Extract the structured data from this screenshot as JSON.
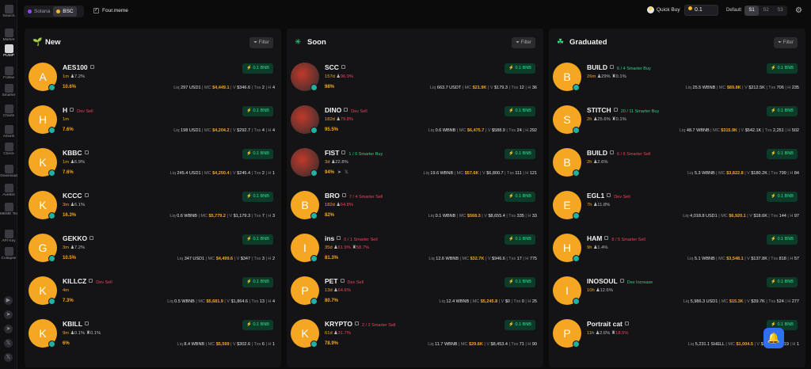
{
  "sidebar": {
    "items": [
      {
        "label": "Search",
        "icon": "search-icon"
      },
      {
        "label": "Market",
        "icon": "market-icon"
      },
      {
        "label": "PUMP",
        "icon": "pump-icon"
      },
      {
        "label": "Follow",
        "icon": "follow-icon"
      },
      {
        "label": "Smarter",
        "icon": "smarter-icon"
      },
      {
        "label": "Charts",
        "icon": "charts-icon"
      },
      {
        "label": "Assets",
        "icon": "assets-icon"
      },
      {
        "label": "Check",
        "icon": "check-icon"
      },
      {
        "label": "Download",
        "icon": "download-icon"
      },
      {
        "label": "AveBot",
        "icon": "avebot-icon"
      },
      {
        "label": "MEME Team",
        "icon": "meme-team-icon"
      },
      {
        "label": "API Key",
        "icon": "api-key-icon"
      },
      {
        "label": "Collapse",
        "icon": "collapse-icon"
      }
    ],
    "social": [
      "youtube-icon",
      "telegram-icon",
      "telegram-icon",
      "x-icon",
      "x-icon"
    ]
  },
  "topbar": {
    "chains": [
      "Solana",
      "BSC"
    ],
    "platform": "Four.meme",
    "quick_buy_label": "Quick Buy",
    "quick_buy_value": "0.1",
    "default_label": "Default",
    "slots": [
      "S1",
      "S2",
      "S3"
    ]
  },
  "panels": [
    {
      "title": "New",
      "filter": "Filter",
      "cards": [
        {
          "name": "AES100",
          "letter": "A",
          "tag": "",
          "tag_class": "",
          "age": "1m",
          "extra": "7.2%",
          "extra2": "",
          "pct": "10.6%",
          "liq": "297 USD1",
          "mc": "$4,449.1",
          "vol": "$346.6",
          "txs": "2",
          "h": "4"
        },
        {
          "name": "H",
          "letter": "H",
          "tag": "Dev Sell",
          "tag_class": "red",
          "age": "1m",
          "extra": "",
          "extra2": "",
          "pct": "7.6%",
          "liq": "198 USD1",
          "mc": "$4,204.2",
          "vol": "$292.7",
          "txs": "4",
          "h": "4"
        },
        {
          "name": "KBBC",
          "letter": "K",
          "tag": "",
          "tag_class": "",
          "age": "1m",
          "extra": "6.9%",
          "extra2": "",
          "pct": "7.6%",
          "liq": "245.4 USD1",
          "mc": "$4,250.4",
          "vol": "$245.4",
          "txs": "2",
          "h": "1"
        },
        {
          "name": "KCCC",
          "letter": "K",
          "tag": "",
          "tag_class": "",
          "age": "3m",
          "extra": "6.1%",
          "extra2": "",
          "pct": "16.3%",
          "liq": "0.6 WBNB",
          "mc": "$5,779.2",
          "vol": "$1,179.3",
          "txs": "7",
          "h": "3"
        },
        {
          "name": "GEKKO",
          "letter": "G",
          "tag": "",
          "tag_class": "",
          "age": "3m",
          "extra": "7.2%",
          "extra2": "",
          "pct": "10.5%",
          "liq": "347 USD1",
          "mc": "$4,499.6",
          "vol": "$347",
          "txs": "3",
          "h": "2"
        },
        {
          "name": "KILLCZ",
          "letter": "K",
          "tag": "Dev Sell",
          "tag_class": "red",
          "age": "4m",
          "extra": "",
          "extra2": "",
          "pct": "7.3%",
          "liq": "0.5 WBNB",
          "mc": "$5,681.9",
          "vol": "$1,864.6",
          "txs": "13",
          "h": "4"
        },
        {
          "name": "KBILL",
          "letter": "K",
          "tag": "",
          "tag_class": "",
          "age": "9m",
          "extra": "0.1%",
          "extra2": "0.1%",
          "pct": "6%",
          "liq": "8.4 WBNB",
          "mc": "$5,599",
          "vol": "$302.6",
          "txs": "6",
          "h": "1"
        }
      ]
    },
    {
      "title": "Soon",
      "filter": "Filter",
      "cards": [
        {
          "name": "SCC",
          "letter": "",
          "img": true,
          "tag": "",
          "tag_class": "",
          "age": "157d",
          "extra": "96.9%",
          "extra_red": true,
          "extra2": "",
          "pct": "98%",
          "liq": "663.7 USDT",
          "mc": "$21.9K",
          "vol": "$179.3",
          "txs": "12",
          "h": "36"
        },
        {
          "name": "DINO",
          "letter": "",
          "img": true,
          "tag": "Dev Sell",
          "tag_class": "red",
          "age": "182d",
          "extra": "79.8%",
          "extra_red": true,
          "extra2": "",
          "pct": "95.5%",
          "liq": "0.6 WBNB",
          "mc": "$6,475.7",
          "vol": "$588.9",
          "txs": "24",
          "h": "292"
        },
        {
          "name": "FIST",
          "letter": "",
          "img": true,
          "tag": "1 / 0 Smarter Buy",
          "tag_class": "green",
          "age": "3d",
          "extra": "22.8%",
          "extra_red": false,
          "extra2": "",
          "pct": "94%",
          "liq": "19.6 WBNB",
          "mc": "$57.6K",
          "vol": "$6,800.7",
          "txs": "111",
          "h": "121"
        },
        {
          "name": "BRO",
          "letter": "B",
          "tag": "7 / 4 Smarter Sell",
          "tag_class": "red",
          "age": "182d",
          "extra": "64.8%",
          "extra_red": true,
          "extra2": "",
          "pct": "82%",
          "liq": "0.1 WBNB",
          "mc": "$568.3",
          "vol": "$8,655.4",
          "txs": "335",
          "h": "33"
        },
        {
          "name": "ins",
          "letter": "I",
          "tag": "0 / 1 Smarter Sell",
          "tag_class": "red",
          "age": "35d",
          "extra": "61.9%",
          "extra_red": true,
          "extra2": "58.7%",
          "pct": "81.3%",
          "liq": "12.6 WBNB",
          "mc": "$32.7K",
          "vol": "$946.6",
          "txs": "17",
          "h": "775"
        },
        {
          "name": "PET",
          "letter": "P",
          "tag": "Dev Sell",
          "tag_class": "red",
          "age": "13d",
          "extra": "64.6%",
          "extra_red": true,
          "extra2": "",
          "pct": "80.7%",
          "liq": "12.4 WBNB",
          "mc": "$5,245.8",
          "vol": "$0",
          "txs": "0",
          "h": "25"
        },
        {
          "name": "KRYPTO",
          "letter": "K",
          "tag": "2 / 2 Smarter Sell",
          "tag_class": "red",
          "age": "61d",
          "extra": "31.7%",
          "extra_red": true,
          "extra2": "",
          "pct": "78.9%",
          "liq": "11.7 WBNB",
          "mc": "$29.6K",
          "vol": "$8,453.4",
          "txs": "71",
          "h": "90"
        }
      ]
    },
    {
      "title": "Graduated",
      "filter": "Filter",
      "cards": [
        {
          "name": "BUILD",
          "letter": "B",
          "tag": "6 / 4 Smarter Buy",
          "tag_class": "green",
          "age": "26m",
          "extra": "29%",
          "extra_red": false,
          "extra2": "0.1%",
          "pct": "",
          "liq": "25.5 WBNB",
          "mc": "$89.8K",
          "vol": "$212.5K",
          "txs": "706",
          "h": "235"
        },
        {
          "name": "STITCH",
          "letter": "S",
          "tag": "20 / 11 Smarter Buy",
          "tag_class": "green",
          "age": "2h",
          "extra": "25.6%",
          "extra_red": false,
          "extra2": "0.1%",
          "pct": "",
          "liq": "48.7 WBNB",
          "mc": "$315.9K",
          "vol": "$542.1K",
          "txs": "2,251",
          "h": "502"
        },
        {
          "name": "BUILD",
          "letter": "B",
          "tag": "6 / 6 Smarter Sell",
          "tag_class": "red",
          "age": "2h",
          "extra": "2.6%",
          "extra_red": false,
          "extra2": "",
          "pct": "",
          "liq": "5.3 WBNB",
          "mc": "$3,822.8",
          "vol": "$180.2K",
          "txs": "799",
          "h": "84"
        },
        {
          "name": "EGL1",
          "letter": "E",
          "tag": "Dev Sell",
          "tag_class": "red",
          "age": "7h",
          "extra": "11.8%",
          "extra_red": false,
          "extra2": "",
          "pct": "",
          "liq": "4,018.8 USD1",
          "mc": "$6,920.1",
          "vol": "$18.6K",
          "txs": "144",
          "h": "97"
        },
        {
          "name": "HAM",
          "letter": "H",
          "tag": "8 / 5 Smarter Sell",
          "tag_class": "red",
          "age": "9h",
          "extra": "1.4%",
          "extra_red": false,
          "extra2": "",
          "pct": "",
          "liq": "5.1 WBNB",
          "mc": "$3,548.1",
          "vol": "$137.8K",
          "txs": "818",
          "h": "57"
        },
        {
          "name": "INOSOUL",
          "letter": "I",
          "tag": "Dev Increase",
          "tag_class": "green",
          "age": "10h",
          "extra": "12.6%",
          "extra_red": false,
          "extra2": "",
          "pct": "",
          "liq": "5,986.3 USD1",
          "mc": "$15.3K",
          "vol": "$39.7K",
          "txs": "524",
          "h": "277"
        },
        {
          "name": "Portrait cat",
          "letter": "P",
          "tag": "",
          "tag_class": "",
          "age": "11h",
          "extra": "2.6%",
          "extra_red": false,
          "extra2": "18.5%",
          "extra2_red": true,
          "pct": "",
          "liq": "5,231.1 SHELL",
          "mc": "$1,004.5",
          "vol": "$1.3K",
          "txs": "19",
          "h": "1"
        }
      ]
    }
  ],
  "card_labels": {
    "liq": "Liq",
    "mc": "MC",
    "vol": "V",
    "txs": "Txs",
    "h": "H",
    "buy": "0.1 BNB"
  },
  "colors": {
    "accent": "#f5a623",
    "buy_green": "#2fe08a",
    "sell_red": "#f0425a",
    "bell_blue": "#2f6ff0"
  }
}
